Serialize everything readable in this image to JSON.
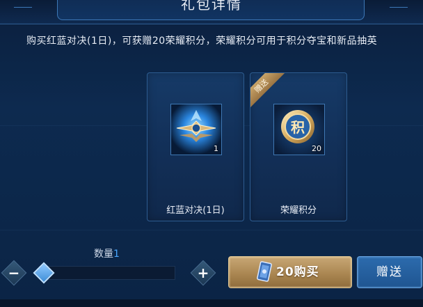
{
  "dialog": {
    "title": "礼包详情",
    "description": "购买红蓝对决(1日)，可获赠20荣耀积分，荣耀积分可用于积分夺宝和新品抽英"
  },
  "items": [
    {
      "icon": "red-blue-duel-emblem-icon",
      "count": "1",
      "label": "红蓝对决(1日)"
    },
    {
      "icon": "honor-points-coin-icon",
      "count": "20",
      "label": "荣耀积分",
      "ribbon": "赠送"
    }
  ],
  "quantity": {
    "label": "数量",
    "value": "1",
    "minus_icon": "minus-icon",
    "plus_icon": "plus-icon"
  },
  "actions": {
    "buy_label": "20购买",
    "buy_icon": "voucher-card-icon",
    "gift_label": "赠送"
  },
  "colors": {
    "accent_blue": "#4aa8ff",
    "gold_button": "#b8955f",
    "blue_button": "#2563a3"
  }
}
